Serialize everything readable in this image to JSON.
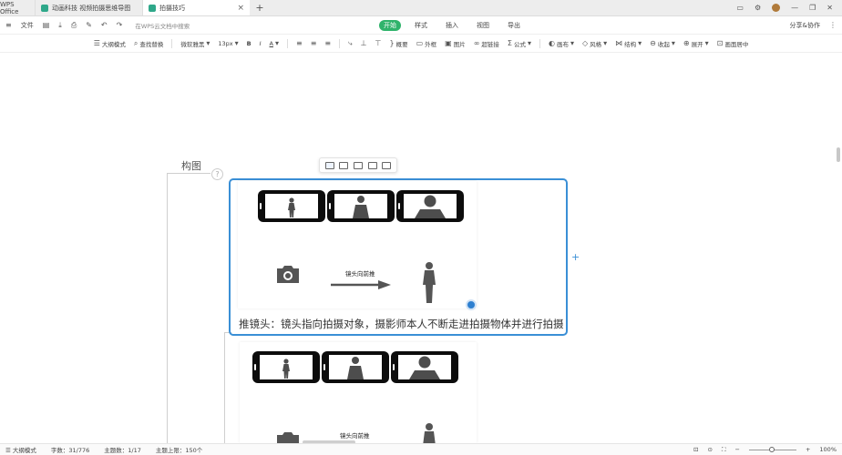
{
  "titlebar": {
    "app_label": "WPS Office",
    "tabs": [
      {
        "label": "动画科技 视频拍摄思维导图",
        "active": false
      },
      {
        "label": "拍摄技巧",
        "active": true
      }
    ],
    "new_tab": "+"
  },
  "menubar": {
    "file_label": "文件",
    "search_hint": "在WPS云文档中搜索",
    "tabs": [
      {
        "label": "开始",
        "active": true
      },
      {
        "label": "样式",
        "active": false
      },
      {
        "label": "插入",
        "active": false
      },
      {
        "label": "视图",
        "active": false
      },
      {
        "label": "导出",
        "active": false
      }
    ],
    "share_label": "分享&协作"
  },
  "toolbar": {
    "items": [
      {
        "icon": "outline-icon",
        "label": "大纲模式"
      },
      {
        "icon": "search-icon",
        "label": "查找替换"
      },
      {
        "icon": "",
        "label": "微软雅黑"
      },
      {
        "icon": "",
        "label": "13px"
      },
      {
        "icon": "bold-icon",
        "label": "B"
      },
      {
        "icon": "italic-icon",
        "label": "I"
      },
      {
        "icon": "font-color-icon",
        "label": "A"
      },
      {
        "icon": "align-left-icon",
        "label": ""
      },
      {
        "icon": "align-center-icon",
        "label": ""
      },
      {
        "icon": "align-right-icon",
        "label": ""
      },
      {
        "icon": "subtopic-icon",
        "label": ""
      },
      {
        "icon": "sibling-topic-icon",
        "label": ""
      },
      {
        "icon": "parent-topic-icon",
        "label": ""
      },
      {
        "icon": "summary-icon",
        "label": "概要"
      },
      {
        "icon": "boundary-icon",
        "label": "外框"
      },
      {
        "icon": "image-icon",
        "label": "图片"
      },
      {
        "icon": "link-icon",
        "label": "超链接"
      },
      {
        "icon": "formula-icon",
        "label": "公式"
      },
      {
        "icon": "theme-icon",
        "label": "画布"
      },
      {
        "icon": "style-icon",
        "label": "风格"
      },
      {
        "icon": "structure-icon",
        "label": "结构"
      },
      {
        "icon": "collapse-icon",
        "label": "收起"
      },
      {
        "icon": "expand-icon",
        "label": "展开"
      },
      {
        "icon": "fit-icon",
        "label": "画面居中"
      }
    ]
  },
  "mindmap": {
    "topic_title": "构图",
    "question_mark": "?",
    "caption": "推镜头：镜头指向拍摄对象，摄影师本人不断走进拍摄物体并进行拍摄",
    "image_label_1": "镜头向前推",
    "image_label_2": "镜头向前推",
    "plus": "+"
  },
  "statusbar": {
    "outline_mode": "大纲模式",
    "word_count": "字数：31/776",
    "topic_count": "主题数：1/17",
    "topic_limit": "主题上限：150个",
    "zoom_level": "100%"
  },
  "colors": {
    "accent": "#2fb36b",
    "selection": "#3a8fd6"
  }
}
